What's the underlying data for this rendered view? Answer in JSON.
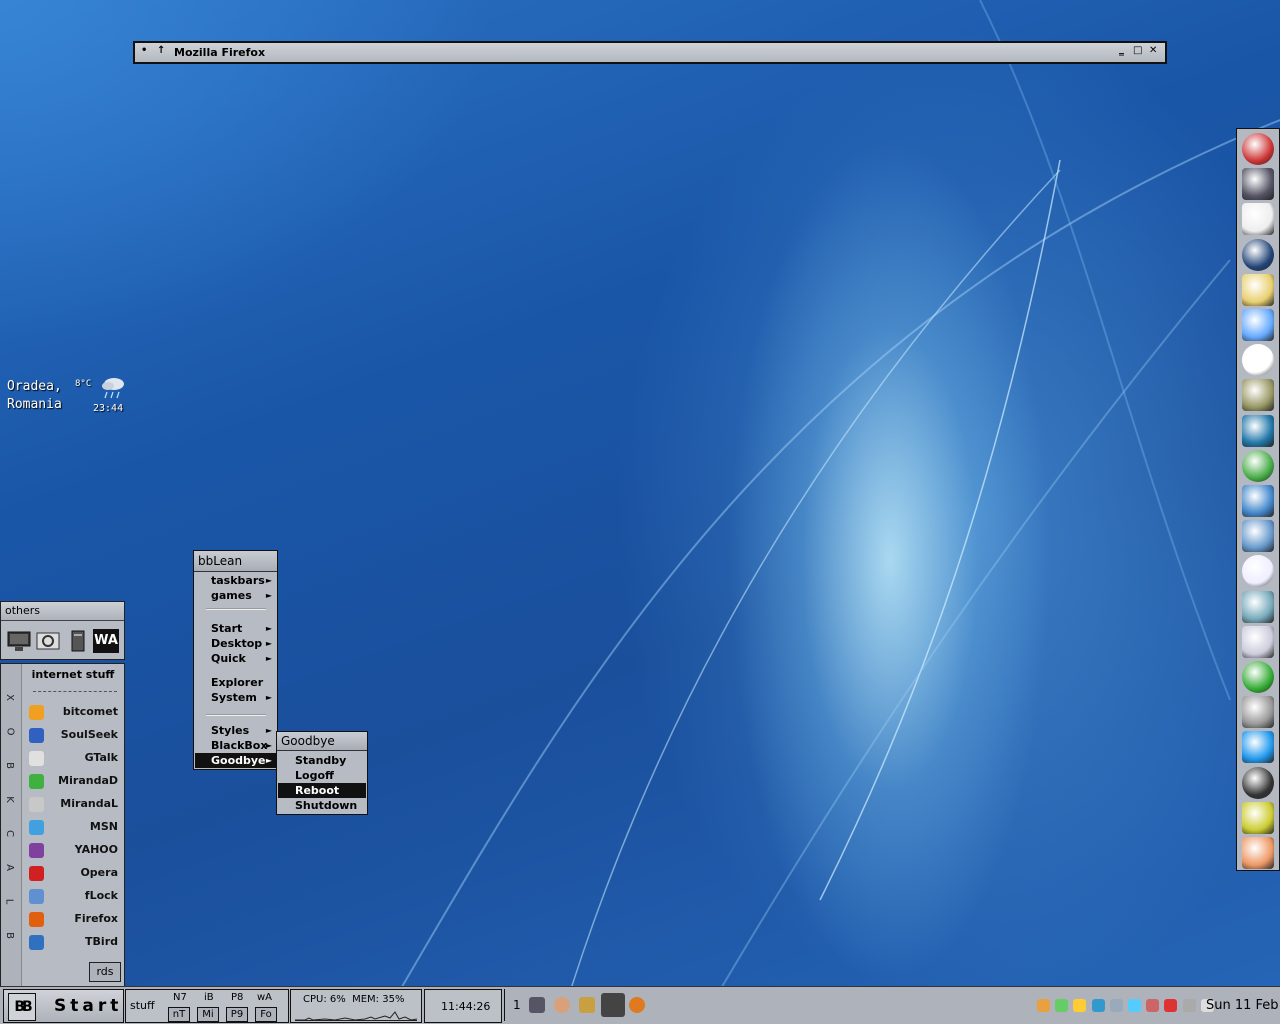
{
  "window": {
    "title": "Mozilla Firefox",
    "menu_glyph": "•",
    "shade_glyph": "↑",
    "minimize": "‗",
    "maximize": "□",
    "close": "✕"
  },
  "weather": {
    "city": "Oradea,",
    "country": "Romania",
    "temp": "8°C",
    "time": "23:44",
    "icon": "rain-cloud-icon"
  },
  "others": {
    "title": "others",
    "icons": [
      "monitor-icon",
      "settings-panel-icon",
      "computer-tower-icon",
      "winamp-icon"
    ],
    "wa_label": "WA"
  },
  "blackbox": {
    "vertical_label": [
      "X",
      "O",
      "B",
      "K",
      "C",
      "A",
      "L",
      "B"
    ],
    "title": "internet stuff",
    "items": [
      {
        "label": "bitcomet",
        "color": "#f0a020"
      },
      {
        "label": "SoulSeek",
        "color": "#3060c0"
      },
      {
        "label": "GTalk",
        "color": "#e0e0e0"
      },
      {
        "label": "MirandaD",
        "color": "#40b040"
      },
      {
        "label": "MirandaL",
        "color": "#c8c8c8"
      },
      {
        "label": "MSN",
        "color": "#40a0e0"
      },
      {
        "label": "YAHOO",
        "color": "#8040a0"
      },
      {
        "label": "Opera",
        "color": "#d02020"
      },
      {
        "label": "fLock",
        "color": "#6090d0"
      },
      {
        "label": "Firefox",
        "color": "#e06010"
      },
      {
        "label": "TBird",
        "color": "#3070c0"
      }
    ],
    "button": "rds"
  },
  "bbmenu": {
    "title": "bbLean",
    "items": [
      "taskbars",
      "games",
      "Start",
      "Desktop",
      "Quick",
      "Explorer",
      "System",
      "Styles",
      "BlackBox",
      "Goodbye"
    ],
    "arrow": "►",
    "active": "Goodbye"
  },
  "goodbye": {
    "title": "Goodbye",
    "items": [
      "Standby",
      "Logoff",
      "Reboot",
      "Shutdown"
    ],
    "active": "Reboot"
  },
  "dock": {
    "icons": [
      "skype-se-icon",
      "counter-strike-icon",
      "cow-icon",
      "globe-icon",
      "folder-icon",
      "search-globe-icon",
      "mplayer-icon",
      "film-reel-icon",
      "thunderbird-icon",
      "pencil-book-icon",
      "cube-icon",
      "laptop-globe-icon",
      "word-document-icon",
      "network-computers-icon",
      "disk-drive-icon",
      "tuu-icon",
      "cd-drive-icon",
      "skype-icon",
      "media-player-icon",
      "ticket-icon",
      "chat-faces-icon"
    ]
  },
  "taskbar": {
    "start_label": "Start",
    "logo": "BB",
    "workspace_name": "stuff",
    "ws_top": [
      "N7",
      "iB",
      "P8",
      "wA"
    ],
    "ws_bottom": [
      "nT",
      "Mi",
      "P9",
      "Fo"
    ],
    "cpu": "CPU: 6%",
    "mem": "MEM: 35%",
    "clock": "11:44:26",
    "workspace_number": "1",
    "task_icons": [
      "save-icon",
      "face-icon",
      "pencil-icon",
      "satellite-icon",
      "firefox-icon"
    ],
    "tray_icons": [
      "bitcomet-tray-icon",
      "gtalk-tray-icon",
      "messenger-tray-icon",
      "network-tray-icon",
      "monitor-tray-icon",
      "settings-tray-icon",
      "window-tray-icon",
      "shield-tray-icon",
      "speaker-tray-icon",
      "volume-tray-icon"
    ],
    "date": "Sun 11 Feb"
  }
}
